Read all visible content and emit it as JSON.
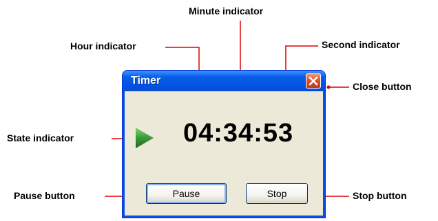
{
  "window": {
    "title": "Timer",
    "time": "04:34:53",
    "buttons": {
      "pause": "Pause",
      "stop": "Stop"
    }
  },
  "annotations": {
    "minute": "Minute indicator",
    "hour": "Hour indicator",
    "second": "Second indicator",
    "close": "Close button",
    "state": "State indicator",
    "pause": "Pause button",
    "stop": "Stop button"
  },
  "colors": {
    "annotation_line": "#e00000",
    "titlebar": "#0054e3",
    "window_body": "#ece9d8",
    "close_button": "#e0502a",
    "state_arrow": "#3a9a3a"
  },
  "icons": {
    "close": "close-icon",
    "state": "play-icon"
  }
}
